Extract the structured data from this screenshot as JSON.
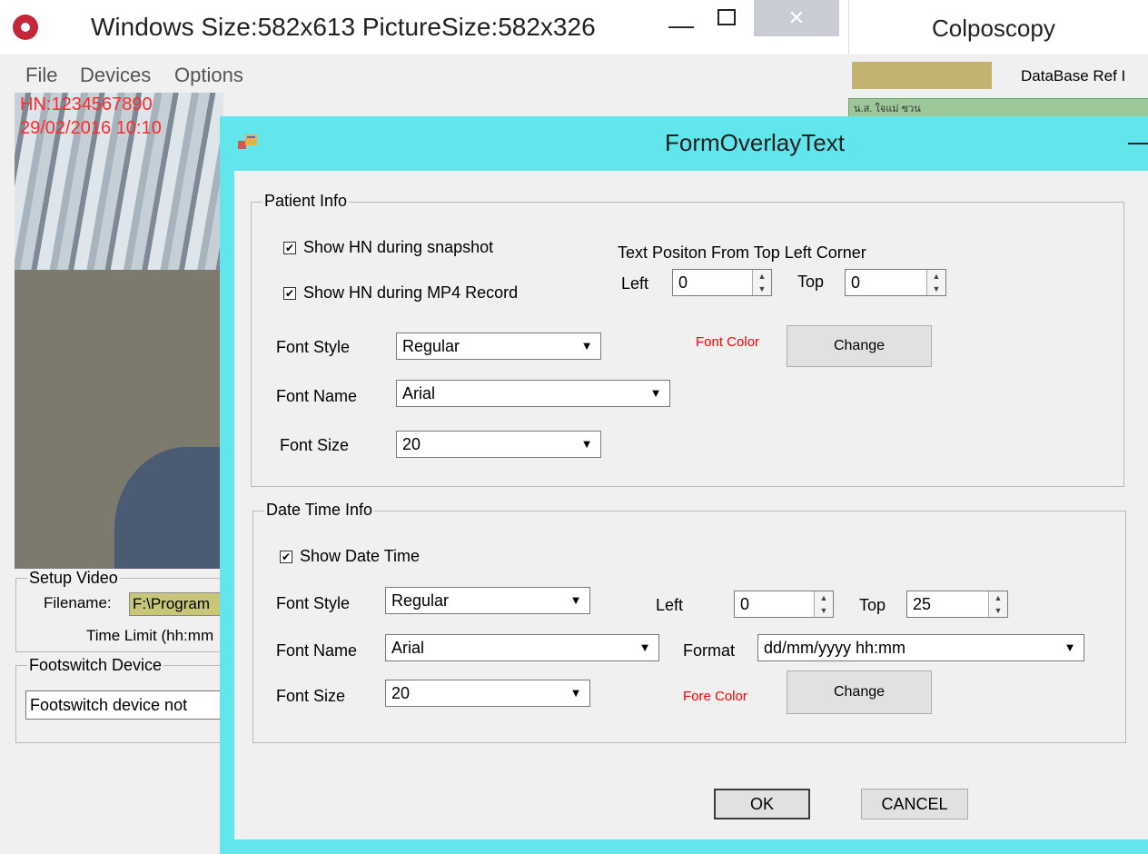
{
  "main_window": {
    "title": "Windows Size:582x613 PictureSize:582x326",
    "minimize": "—",
    "close": "✕",
    "menu": [
      "File",
      "Devices",
      "Options"
    ]
  },
  "video": {
    "overlay_hn": "HN:1234567890",
    "overlay_datetime": "29/02/2016 10:10"
  },
  "setup_video": {
    "legend": "Setup Video",
    "filename_label": "Filename:",
    "filename_value": "F:\\Program",
    "time_limit_label": "Time Limit (hh:mm"
  },
  "footswitch": {
    "legend": "Footswitch Device",
    "status": "Footswitch device not"
  },
  "right_panel": {
    "title": "Colposcopy",
    "db_ref_label": "DataBase Ref I",
    "row_text": "น.ส. ใจแม่ ซวน"
  },
  "dialog": {
    "title": "FormOverlayText",
    "minimize": "—",
    "patient_info": {
      "legend": "Patient Info",
      "show_hn_snapshot": "Show HN during snapshot",
      "show_hn_snapshot_checked": true,
      "show_hn_mp4": "Show HN during MP4 Record",
      "show_hn_mp4_checked": true,
      "text_position_label": "Text Positon From Top Left Corner",
      "left_label": "Left",
      "left_value": "0",
      "top_label": "Top",
      "top_value": "0",
      "font_style_label": "Font Style",
      "font_style_value": "Regular",
      "font_name_label": "Font Name",
      "font_name_value": "Arial",
      "font_size_label": "Font Size",
      "font_size_value": "20",
      "font_color_label": "Font Color",
      "font_color": "#ff0000",
      "change_label": "Change"
    },
    "date_time_info": {
      "legend": "Date Time Info",
      "show_date_time": "Show Date Time",
      "show_date_time_checked": true,
      "font_style_label": "Font Style",
      "font_style_value": "Regular",
      "font_name_label": "Font Name",
      "font_name_value": "Arial",
      "font_size_label": "Font Size",
      "font_size_value": "20",
      "left_label": "Left",
      "left_value": "0",
      "top_label": "Top",
      "top_value": "25",
      "format_label": "Format",
      "format_value": "dd/mm/yyyy hh:mm",
      "fore_color_label": "Fore Color",
      "fore_color": "#ff0000",
      "change_label": "Change"
    },
    "ok_label": "OK",
    "cancel_label": "CANCEL"
  },
  "colors": {
    "dialog_frame": "#63e5ec",
    "app_icon": "#c2273a",
    "filename_field": "#c8c678",
    "db_bar": "#c2b371",
    "row_green": "#9cc899"
  }
}
